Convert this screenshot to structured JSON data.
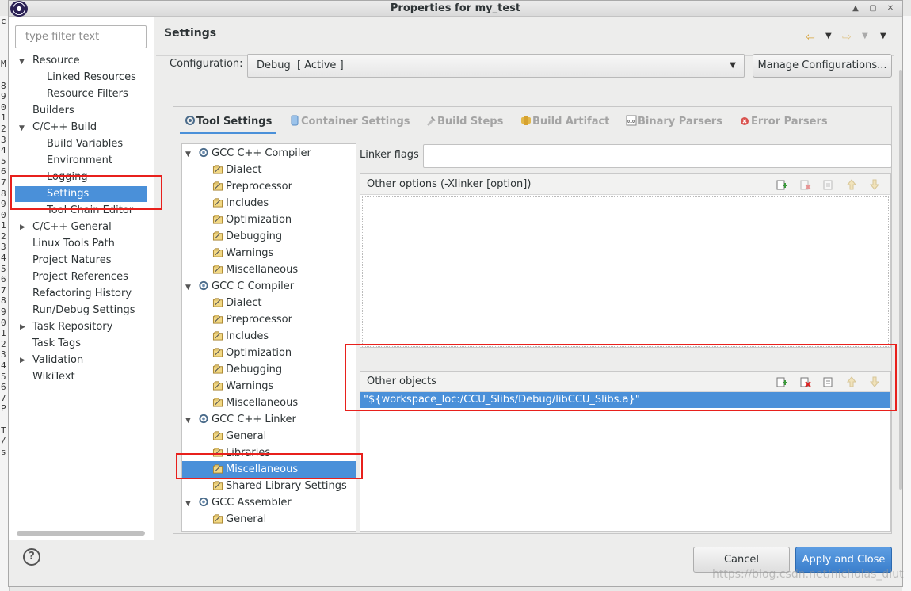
{
  "window": {
    "title": "Properties for my_test",
    "controls": [
      "up-icon",
      "restore-icon",
      "close-icon"
    ]
  },
  "left_nav": {
    "filter_placeholder": "type filter text",
    "items": [
      {
        "label": "Resource",
        "level": 0,
        "expanded": true
      },
      {
        "label": "Linked Resources",
        "level": 1
      },
      {
        "label": "Resource Filters",
        "level": 1
      },
      {
        "label": "Builders",
        "level": 0
      },
      {
        "label": "C/C++ Build",
        "level": 0,
        "expanded": true
      },
      {
        "label": "Build Variables",
        "level": 1
      },
      {
        "label": "Environment",
        "level": 1
      },
      {
        "label": "Logging",
        "level": 1
      },
      {
        "label": "Settings",
        "level": 1,
        "selected": true
      },
      {
        "label": "Tool Chain Editor",
        "level": 1
      },
      {
        "label": "C/C++ General",
        "level": 0,
        "expanded": false
      },
      {
        "label": "Linux Tools Path",
        "level": 0
      },
      {
        "label": "Project Natures",
        "level": 0
      },
      {
        "label": "Project References",
        "level": 0
      },
      {
        "label": "Refactoring History",
        "level": 0
      },
      {
        "label": "Run/Debug Settings",
        "level": 0
      },
      {
        "label": "Task Repository",
        "level": 0,
        "expanded": false
      },
      {
        "label": "Task Tags",
        "level": 0
      },
      {
        "label": "Validation",
        "level": 0,
        "expanded": false
      },
      {
        "label": "WikiText",
        "level": 0
      }
    ]
  },
  "main": {
    "title": "Settings",
    "configuration_label": "Configuration:",
    "configuration_value": "Debug  [ Active ]",
    "manage_label": "Manage Configurations...",
    "tabs": [
      {
        "label": "Tool Settings",
        "icon": "tool-settings-icon",
        "active": true
      },
      {
        "label": "Container Settings",
        "icon": "container-icon"
      },
      {
        "label": "Build Steps",
        "icon": "build-steps-icon"
      },
      {
        "label": "Build Artifact",
        "icon": "build-artifact-icon"
      },
      {
        "label": "Binary Parsers",
        "icon": "binary-parsers-icon"
      },
      {
        "label": "Error Parsers",
        "icon": "error-parsers-icon"
      }
    ],
    "tool_tree": [
      {
        "label": "GCC C++ Compiler",
        "type": "tool"
      },
      {
        "label": "Dialect",
        "type": "option"
      },
      {
        "label": "Preprocessor",
        "type": "option"
      },
      {
        "label": "Includes",
        "type": "option"
      },
      {
        "label": "Optimization",
        "type": "option"
      },
      {
        "label": "Debugging",
        "type": "option"
      },
      {
        "label": "Warnings",
        "type": "option"
      },
      {
        "label": "Miscellaneous",
        "type": "option"
      },
      {
        "label": "GCC C Compiler",
        "type": "tool"
      },
      {
        "label": "Dialect",
        "type": "option"
      },
      {
        "label": "Preprocessor",
        "type": "option"
      },
      {
        "label": "Includes",
        "type": "option"
      },
      {
        "label": "Optimization",
        "type": "option"
      },
      {
        "label": "Debugging",
        "type": "option"
      },
      {
        "label": "Warnings",
        "type": "option"
      },
      {
        "label": "Miscellaneous",
        "type": "option"
      },
      {
        "label": "GCC C++ Linker",
        "type": "tool"
      },
      {
        "label": "General",
        "type": "option"
      },
      {
        "label": "Libraries",
        "type": "option"
      },
      {
        "label": "Miscellaneous",
        "type": "option",
        "selected": true
      },
      {
        "label": "Shared Library Settings",
        "type": "option"
      },
      {
        "label": "GCC Assembler",
        "type": "tool"
      },
      {
        "label": "General",
        "type": "option"
      }
    ],
    "linker_flags_label": "Linker flags",
    "linker_flags_value": "",
    "other_options_label": "Other options (-Xlinker [option])",
    "other_objects_label": "Other objects",
    "other_objects": [
      "\"${workspace_loc:/CCU_Slibs/Debug/libCCU_Slibs.a}\""
    ],
    "list_tools": [
      "add-icon",
      "delete-icon",
      "edit-icon",
      "move-up-icon",
      "move-down-icon"
    ]
  },
  "footer": {
    "cancel_label": "Cancel",
    "apply_label": "Apply and Close",
    "watermark": "https://blog.csdn.net/nicholas_dlut"
  },
  "colors": {
    "selection": "#4a90d9",
    "highlight_box": "#e8201c",
    "apply_button": "#3b7fcc"
  }
}
